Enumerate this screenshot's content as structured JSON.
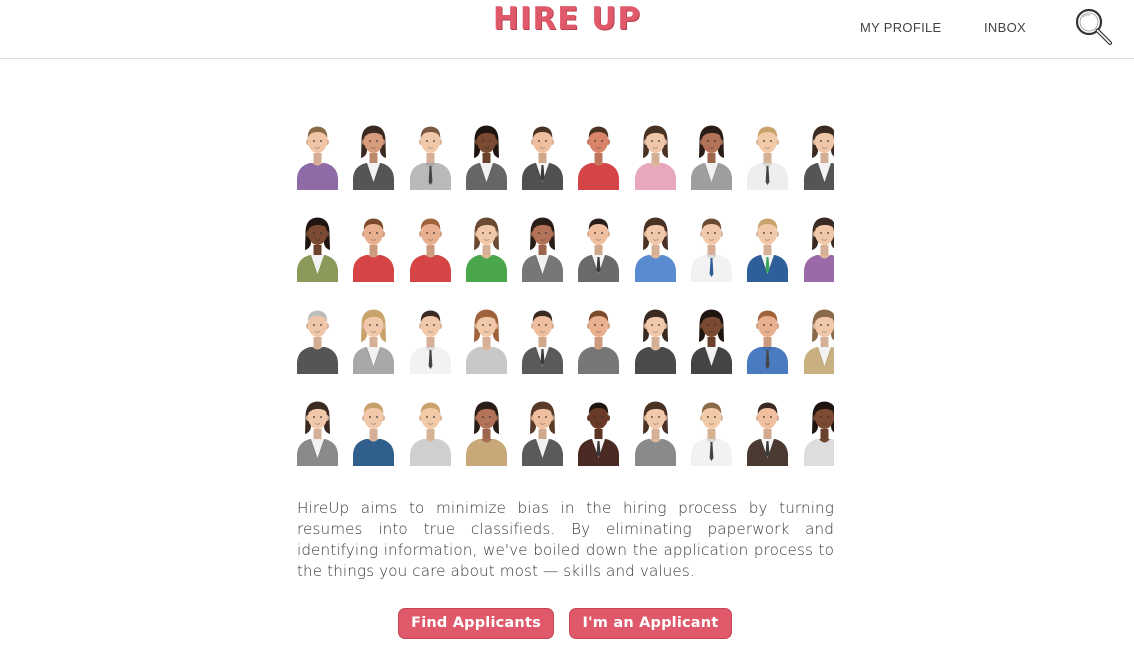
{
  "header": {
    "logo": "HIRE UP",
    "nav": {
      "profile": "MY PROFILE",
      "inbox": "INBOX"
    },
    "search_icon": "search-icon"
  },
  "avatars": [
    {
      "skin": "#f2c4a6",
      "hair": "#8a6a48",
      "shirt": "#8e6aa6",
      "style": "tee"
    },
    {
      "skin": "#d69c7c",
      "hair": "#3a2a22",
      "shirt": "#555555",
      "style": "suit-f"
    },
    {
      "skin": "#f2c8aa",
      "hair": "#7a5a40",
      "shirt": "#b9b9b9",
      "style": "shirt-tie"
    },
    {
      "skin": "#7a4a32",
      "hair": "#1e1410",
      "shirt": "#666666",
      "style": "suit-f"
    },
    {
      "skin": "#efbfa0",
      "hair": "#4a3325",
      "shirt": "#505050",
      "style": "suit"
    },
    {
      "skin": "#d9856a",
      "hair": "#4a3325",
      "shirt": "#d64545",
      "style": "tee"
    },
    {
      "skin": "#f0c7aa",
      "hair": "#4a3325",
      "shirt": "#e8a8bc",
      "style": "blouse"
    },
    {
      "skin": "#b37358",
      "hair": "#2a1c16",
      "shirt": "#9e9e9e",
      "style": "suit-f"
    },
    {
      "skin": "#f2caa8",
      "hair": "#c8a26a",
      "shirt": "#eeeeee",
      "style": "shirt-tie"
    },
    {
      "skin": "#f0c6a8",
      "hair": "#3a2a22",
      "shirt": "#555555",
      "style": "suit-f"
    },
    {
      "skin": "#7a4a32",
      "hair": "#1e1410",
      "shirt": "#8a9a5a",
      "style": "suit-f"
    },
    {
      "skin": "#e8b08e",
      "hair": "#7a4a2a",
      "shirt": "#d64545",
      "style": "tee"
    },
    {
      "skin": "#e8b08e",
      "hair": "#a0623a",
      "shirt": "#d64545",
      "style": "tee"
    },
    {
      "skin": "#f2c8aa",
      "hair": "#6a4a32",
      "shirt": "#4aa64a",
      "style": "blouse"
    },
    {
      "skin": "#b37358",
      "hair": "#2a1c16",
      "shirt": "#777777",
      "style": "suit-f"
    },
    {
      "skin": "#efbfa0",
      "hair": "#2a1c16",
      "shirt": "#6a6a6a",
      "style": "suit"
    },
    {
      "skin": "#f2c8aa",
      "hair": "#4a3325",
      "shirt": "#5a8ad0",
      "style": "blouse"
    },
    {
      "skin": "#f2c8aa",
      "hair": "#6a4a32",
      "shirt": "#f2f2f2",
      "style": "shirt-tie-blue"
    },
    {
      "skin": "#f2c8aa",
      "hair": "#c8a26a",
      "shirt": "#2f5f9a",
      "style": "suit-green"
    },
    {
      "skin": "#f2c8aa",
      "hair": "#3a2a22",
      "shirt": "#9a6aa8",
      "style": "blouse"
    },
    {
      "skin": "#f0c6a8",
      "hair": "#bdbdbd",
      "shirt": "#555555",
      "style": "tee"
    },
    {
      "skin": "#f2c8aa",
      "hair": "#c8a26a",
      "shirt": "#a8a8a8",
      "style": "suit-f"
    },
    {
      "skin": "#f2c8aa",
      "hair": "#3a2a22",
      "shirt": "#f2f2f2",
      "style": "shirt-tie"
    },
    {
      "skin": "#f2c8aa",
      "hair": "#a0623a",
      "shirt": "#c8c8c8",
      "style": "blouse"
    },
    {
      "skin": "#efbfa0",
      "hair": "#3a2a22",
      "shirt": "#5a5a5a",
      "style": "suit"
    },
    {
      "skin": "#e8b08e",
      "hair": "#7a4a2a",
      "shirt": "#777777",
      "style": "tee"
    },
    {
      "skin": "#f2c8aa",
      "hair": "#3a2a22",
      "shirt": "#4a4a4a",
      "style": "blouse"
    },
    {
      "skin": "#7a4a32",
      "hair": "#1e1410",
      "shirt": "#444444",
      "style": "suit-f"
    },
    {
      "skin": "#e8b08e",
      "hair": "#a0623a",
      "shirt": "#4a7ac0",
      "style": "shirt-tie"
    },
    {
      "skin": "#f2c8aa",
      "hair": "#8a6a48",
      "shirt": "#c8b080",
      "style": "suit-f"
    },
    {
      "skin": "#f2c8aa",
      "hair": "#3a2a22",
      "shirt": "#8a8a8a",
      "style": "suit-f"
    },
    {
      "skin": "#f2c8aa",
      "hair": "#c8a26a",
      "shirt": "#2f5f8a",
      "style": "tee"
    },
    {
      "skin": "#f2caa8",
      "hair": "#c8a26a",
      "shirt": "#cfcfcf",
      "style": "tee"
    },
    {
      "skin": "#b37358",
      "hair": "#2a1c16",
      "shirt": "#c8a878",
      "style": "blouse"
    },
    {
      "skin": "#efbfa0",
      "hair": "#5a3a28",
      "shirt": "#5a5a5a",
      "style": "suit-f"
    },
    {
      "skin": "#6a3a28",
      "hair": "#1e1410",
      "shirt": "#4a2a22",
      "style": "suit"
    },
    {
      "skin": "#f2c8aa",
      "hair": "#4a3325",
      "shirt": "#8a8a8a",
      "style": "blouse"
    },
    {
      "skin": "#f2caa8",
      "hair": "#8a6a48",
      "shirt": "#f2f2f2",
      "style": "shirt-tie"
    },
    {
      "skin": "#efbfa0",
      "hair": "#3a2a22",
      "shirt": "#4a3a32",
      "style": "suit"
    },
    {
      "skin": "#7a4a32",
      "hair": "#1e1410",
      "shirt": "#dddddd",
      "style": "blouse"
    }
  ],
  "intro": {
    "text": "HireUp aims to minimize bias in the hiring process by turning resumes into true classifieds. By eliminating paperwork and identifying information, we've boiled down the application process to the things you care about most — skills and values."
  },
  "actions": {
    "find_applicants": "Find Applicants",
    "im_an_applicant": "I'm an Applicant"
  },
  "colors": {
    "brand": "#e0596a",
    "header_border": "#dcdcdc"
  }
}
